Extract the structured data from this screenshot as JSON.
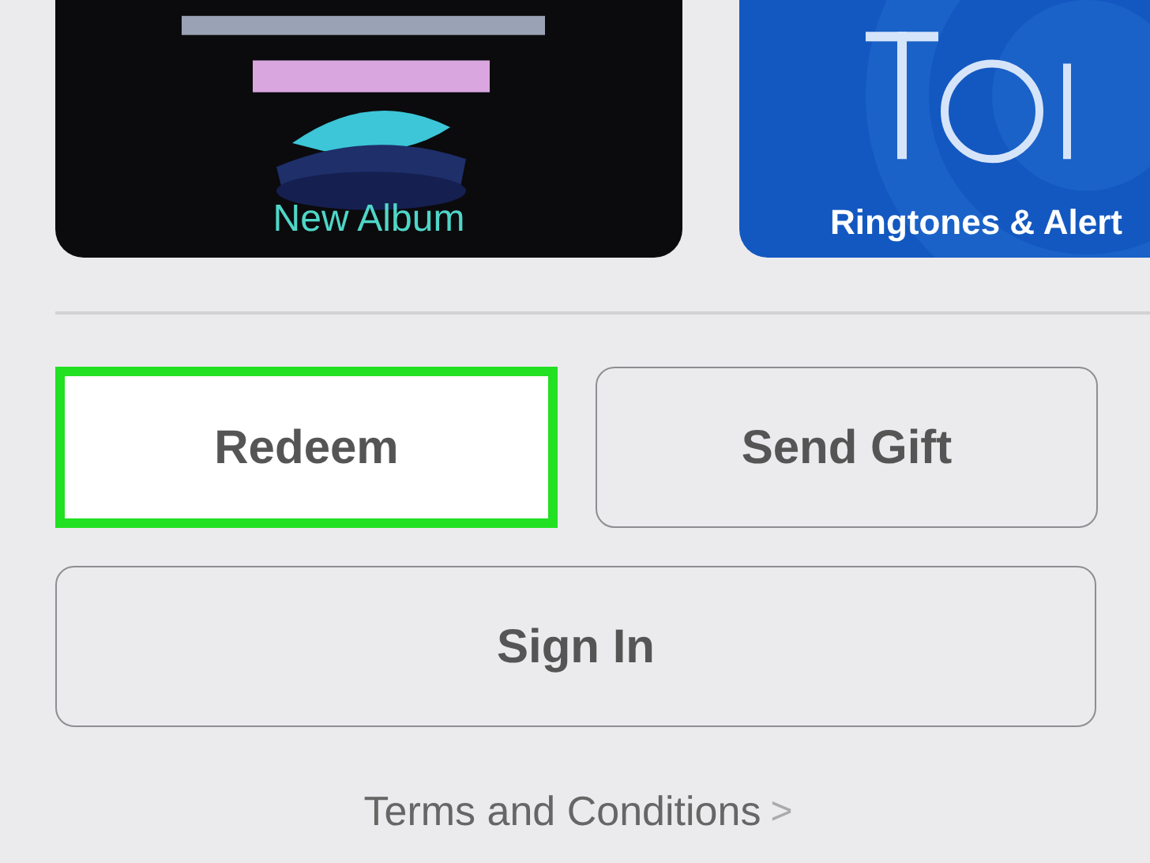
{
  "tiles": [
    {
      "kind": "album",
      "caption": "New Album"
    },
    {
      "kind": "ringtones",
      "caption": "Ringtones & Alert"
    }
  ],
  "buttons": [
    {
      "label": "Redeem",
      "highlighted": true
    },
    {
      "label": "Send Gift",
      "highlighted": false
    }
  ],
  "sign_in": {
    "label": "Sign In"
  },
  "terms_link": {
    "label": "Terms and Conditions",
    "chevron": ">"
  }
}
